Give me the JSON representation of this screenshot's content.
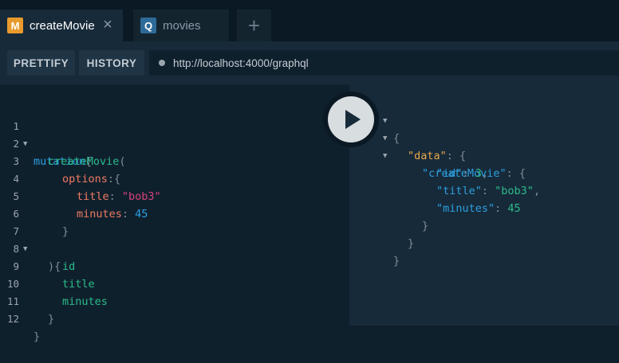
{
  "tabs": [
    {
      "badge": "M",
      "label": "createMovie",
      "close": "×"
    },
    {
      "badge": "Q",
      "label": "movies"
    }
  ],
  "new_tab": "+",
  "toolbar": {
    "prettify": "PRETTIFY",
    "history": "HISTORY",
    "url": "http://localhost:4000/graphql"
  },
  "editor": {
    "line_numbers": [
      "1",
      "2",
      "3",
      "4",
      "5",
      "6",
      "7",
      "8",
      "9",
      "10",
      "11",
      "12"
    ],
    "lines": [
      {
        "t1": "mutation",
        "t2": "{"
      },
      {
        "t1": "createMovie",
        "t2": "("
      },
      {
        "t1": "options",
        "t2": ":{"
      },
      {
        "t1": "title",
        "t2": ": ",
        "t3": "\"bob3\""
      },
      {
        "t1": "minutes",
        "t2": ": ",
        "t3": "45"
      },
      {
        "t1": "}"
      },
      {
        "t1": "){"
      },
      {
        "t1": "id"
      },
      {
        "t1": "title"
      },
      {
        "t1": "minutes"
      },
      {
        "t1": "}"
      },
      {
        "t1": "}"
      }
    ]
  },
  "result": {
    "lines": [
      {
        "t1": "{"
      },
      {
        "t1": "\"data\"",
        "t2": ": {"
      },
      {
        "t1": "\"createMovie\"",
        "t2": ": {"
      },
      {
        "t1": "\"id\"",
        "t2": ": ",
        "t3": "3",
        "t4": ","
      },
      {
        "t1": "\"title\"",
        "t2": ": ",
        "t3": "\"bob3\"",
        "t4": ","
      },
      {
        "t1": "\"minutes\"",
        "t2": ": ",
        "t3": "45"
      },
      {
        "t1": "}"
      },
      {
        "t1": "}"
      },
      {
        "t1": "}"
      }
    ]
  },
  "icons": {
    "fold": "fold-caret-icon",
    "play": "play-icon",
    "close": "close-icon"
  },
  "colors": {
    "mutation_badge": "#e89a2c",
    "query_badge": "#2e6a98",
    "keyword": "#2d9fe0",
    "field": "#2bbc8a",
    "argument": "#f07a62",
    "string": "#d6447a"
  }
}
